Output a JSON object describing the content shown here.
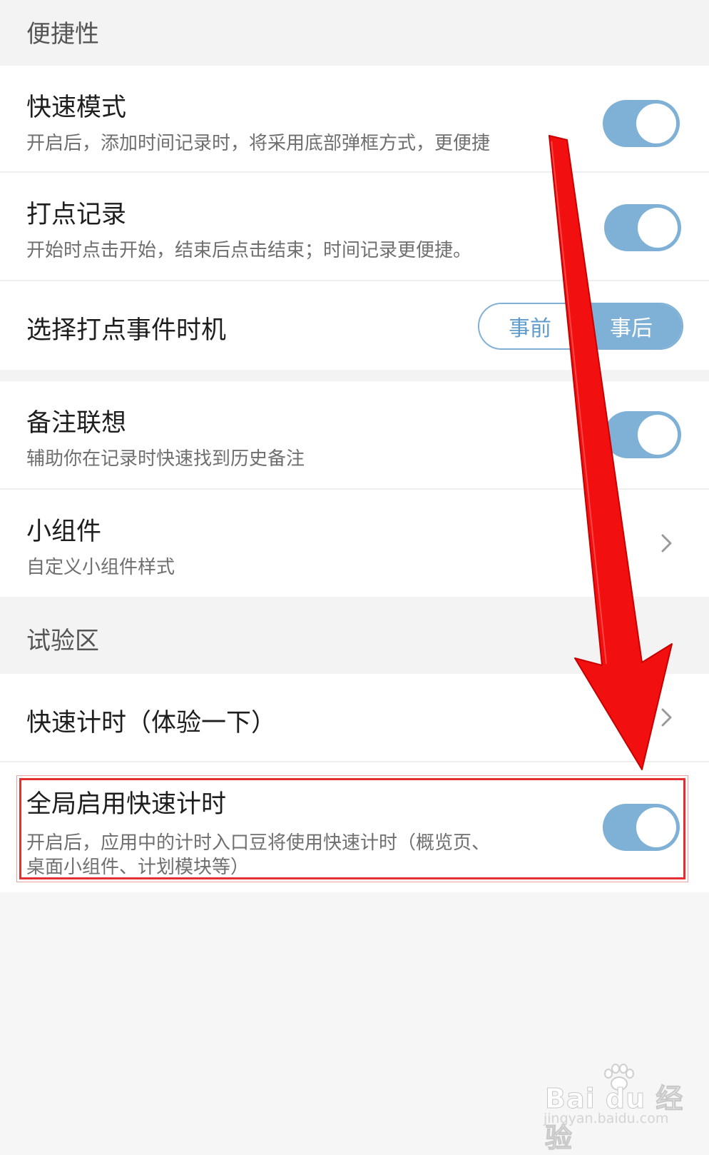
{
  "sections": {
    "convenience": {
      "label": "便捷性"
    },
    "lab": {
      "label": "试验区"
    }
  },
  "items": {
    "quick_mode": {
      "title": "快速模式",
      "desc": "开启后，添加时间记录时，将采用底部弹框方式，更便捷",
      "enabled": true
    },
    "dot_record": {
      "title": "打点记录",
      "desc": "开始时点击开始，结束后点击结束；时间记录更便捷。",
      "enabled": true
    },
    "dot_timing": {
      "title": "选择打点事件时机",
      "options": [
        "事前",
        "事后"
      ],
      "selected": "事后"
    },
    "note_assoc": {
      "title": "备注联想",
      "desc": "辅助你在记录时快速找到历史备注",
      "enabled": true
    },
    "widget": {
      "title": "小组件",
      "desc": "自定义小组件样式"
    },
    "quick_timer": {
      "title": "快速计时（体验一下）"
    },
    "global_quick_timer": {
      "title": "全局启用快速计时",
      "desc_line1": "开启后，应用中的计时入口豆将使用快速计时（概览页、",
      "desc_line2": "桌面小组件、计划模块等）",
      "enabled": true
    }
  },
  "colors": {
    "accent": "#7fb0d6",
    "annotation": "#e32f2f"
  },
  "watermark": {
    "main": "Bai du 经验",
    "sub": "jingyan.baidu.com"
  }
}
